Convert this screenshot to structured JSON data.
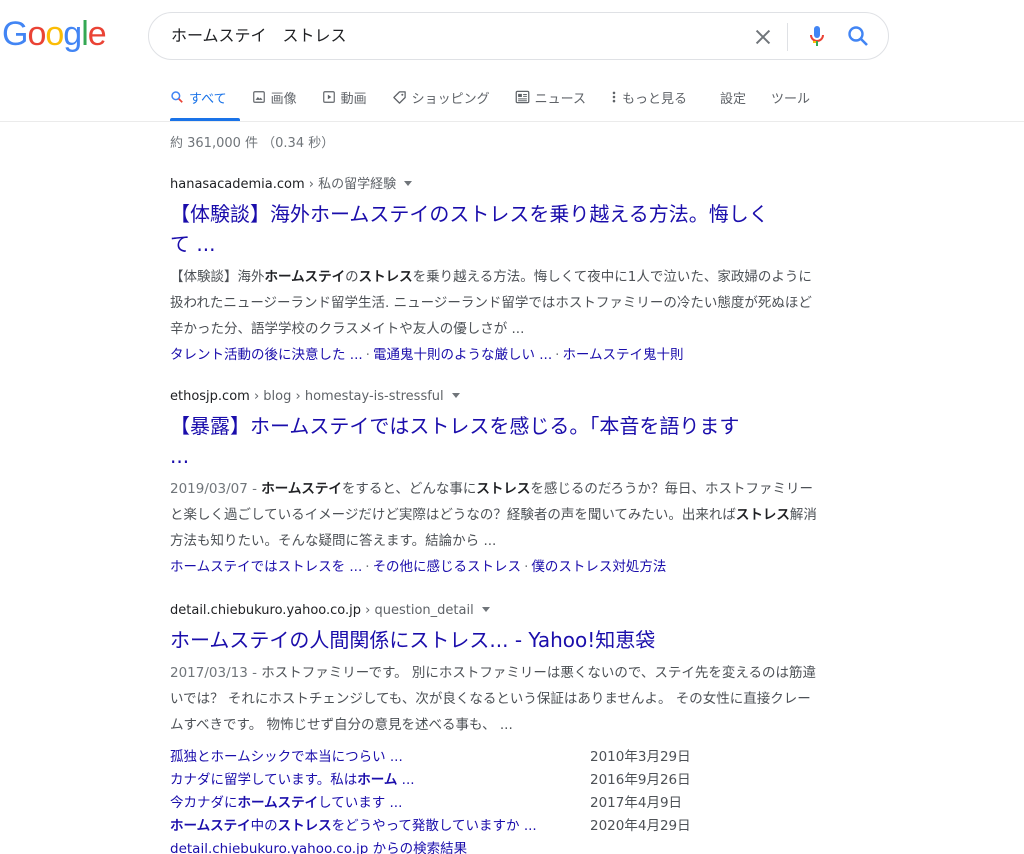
{
  "logo": {
    "text": "Google",
    "letters": [
      {
        "ch": "G",
        "color": "#4285F4"
      },
      {
        "ch": "o",
        "color": "#EA4335"
      },
      {
        "ch": "o",
        "color": "#FBBC05"
      },
      {
        "ch": "g",
        "color": "#4285F4"
      },
      {
        "ch": "l",
        "color": "#34A853"
      },
      {
        "ch": "e",
        "color": "#EA4335"
      }
    ]
  },
  "search": {
    "query": "ホームステイ　ストレス"
  },
  "tabs": [
    {
      "label": "すべて",
      "icon": "search-icon"
    },
    {
      "label": "画像",
      "icon": "image-icon"
    },
    {
      "label": "動画",
      "icon": "video-icon"
    },
    {
      "label": "ショッピング",
      "icon": "tag-icon"
    },
    {
      "label": "ニュース",
      "icon": "news-icon"
    },
    {
      "label": "もっと見る",
      "icon": "more-vert-icon"
    },
    {
      "label": "設定",
      "icon": ""
    },
    {
      "label": "ツール",
      "icon": ""
    }
  ],
  "stats": "約 361,000 件 （0.34 秒）",
  "results": [
    {
      "domain": "hanasacademia.com",
      "path": " › 私の留学経験",
      "title_line1": "【体験談】海外ホームステイのストレスを乗り越える方法。悔しく",
      "title_line2": "て ...",
      "snippet": [
        [
          "",
          "【体験談】海外"
        ],
        [
          "b",
          "ホームステイ"
        ],
        [
          "",
          "の"
        ],
        [
          "b",
          "ストレス"
        ],
        [
          "",
          "を乗り越える方法。悔しくて夜中に1人で泣いた、家政婦のように扱われたニュージーランド留学生活. ニュージーランド留学ではホストファミリーの冷たい態度が死ぬほど辛かった分、語学学校のクラスメイトや友人の優しさが ..."
        ]
      ],
      "sitelinks": [
        "タレント活動の後に決意した ...",
        "電通鬼十則のような厳しい ...",
        "ホームステイ鬼十則"
      ]
    },
    {
      "domain": "ethosjp.com",
      "path": " › blog › homestay-is-stressful",
      "title_line1": "【暴露】ホームステイではストレスを感じる。「本音を語ります",
      "title_line2": "...",
      "date": "2019/03/07 - ",
      "snippet": [
        [
          "b",
          "ホームステイ"
        ],
        [
          "",
          "をすると、どんな事に"
        ],
        [
          "b",
          "ストレス"
        ],
        [
          "",
          "を感じるのだろうか？毎日、ホストファミリーと楽しく過ごしているイメージだけど実際はどうなの？経験者の声を聞いてみたい。出来れば"
        ],
        [
          "b",
          "ストレス"
        ],
        [
          "",
          "解消方法も知りたい。そんな疑問に答えます。結論から ..."
        ]
      ],
      "sitelinks": [
        "ホームステイではストレスを ...",
        "その他に感じるストレス",
        "僕のストレス対処方法"
      ]
    },
    {
      "domain": "detail.chiebukuro.yahoo.co.jp",
      "path": " › question_detail",
      "title_line1": "ホームステイの人間関係にストレス... - Yahoo!知恵袋",
      "date": "2017/03/13 - ",
      "snippet": [
        [
          "",
          "ホストファミリーです。 別にホストファミリーは悪くないので、ステイ先を変えるのは筋違いでは？ それにホストチェンジしても、次が良くなるという保証はありませんよ。 その女性に直接クレームすべきです。 物怖じせず自分の意見を述べる事も、 ..."
        ]
      ],
      "questions": [
        {
          "parts": [
            [
              "",
              "孤独とホームシックで本当につらい ..."
            ]
          ],
          "date": "2010年3月29日"
        },
        {
          "parts": [
            [
              "",
              "カナダに留学しています。私は"
            ],
            [
              "b",
              "ホーム"
            ],
            [
              "",
              ""
            ],
            [
              "",
              " ..."
            ]
          ],
          "date": "2016年9月26日"
        },
        {
          "parts": [
            [
              "",
              "今カナダに"
            ],
            [
              "b",
              "ホームステイ"
            ],
            [
              "",
              "しています ..."
            ]
          ],
          "date": "2017年4月9日"
        },
        {
          "parts": [
            [
              "b",
              "ホームステイ"
            ],
            [
              "",
              "中の"
            ],
            [
              "b",
              "ストレス"
            ],
            [
              "",
              "をどうやって発散していますか ..."
            ]
          ],
          "date": "2020年4月29日"
        }
      ],
      "more": "detail.chiebukuro.yahoo.co.jp からの検索結果"
    }
  ]
}
